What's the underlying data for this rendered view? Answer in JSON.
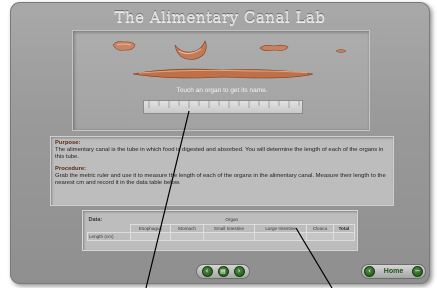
{
  "app": {
    "title": "The Alimentary Canal Lab"
  },
  "specimens": {
    "hint": "Touch an organ to get its name.",
    "organs": [
      {
        "id": "esophagus",
        "icon": "esophagus-icon"
      },
      {
        "id": "stomach",
        "icon": "stomach-icon"
      },
      {
        "id": "large-intestine",
        "icon": "large-intestine-icon"
      },
      {
        "id": "anus",
        "icon": "anus-icon"
      },
      {
        "id": "small-intestine",
        "icon": "small-intestine-icon"
      }
    ],
    "ruler_icon": "metric-ruler-icon"
  },
  "info": {
    "purpose_heading": "Purpose:",
    "purpose_text": "The alimentary canal is the tube in which food is digested and absorbed. You will determine the length of each of the organs in this tube.",
    "procedure_heading": "Procedure:",
    "procedure_text": "Grab the metric ruler and use it to measure the length of each of the organs in the alimentary canal. Measure their length to the nearest cm and record it in the data table below."
  },
  "data_table": {
    "label": "Data:",
    "group_header": "Organ",
    "columns": [
      "Esophagus",
      "Stomach",
      "Small Intestine",
      "Large Intestine",
      "Cloaca",
      "Total"
    ],
    "row_header": "Length (cm)",
    "values": [
      "",
      "",
      "",
      "",
      "",
      ""
    ]
  },
  "nav": {
    "prev_icon": "arrow-left-icon",
    "print_icon": "printer-icon",
    "next_icon": "arrow-right-icon",
    "prev_glyph": "‹",
    "print_glyph": "▤",
    "next_glyph": "›"
  },
  "home": {
    "label": "Home",
    "icon": "home-icon",
    "minimize_icon": "minus-icon",
    "home_glyph": "‹",
    "minus_glyph": "−"
  },
  "colors": {
    "frame": "#9a9a9a",
    "title_text": "#dcdcdc",
    "organ_tissue": "#c77f5a",
    "nav_green": "#2e6a24"
  }
}
